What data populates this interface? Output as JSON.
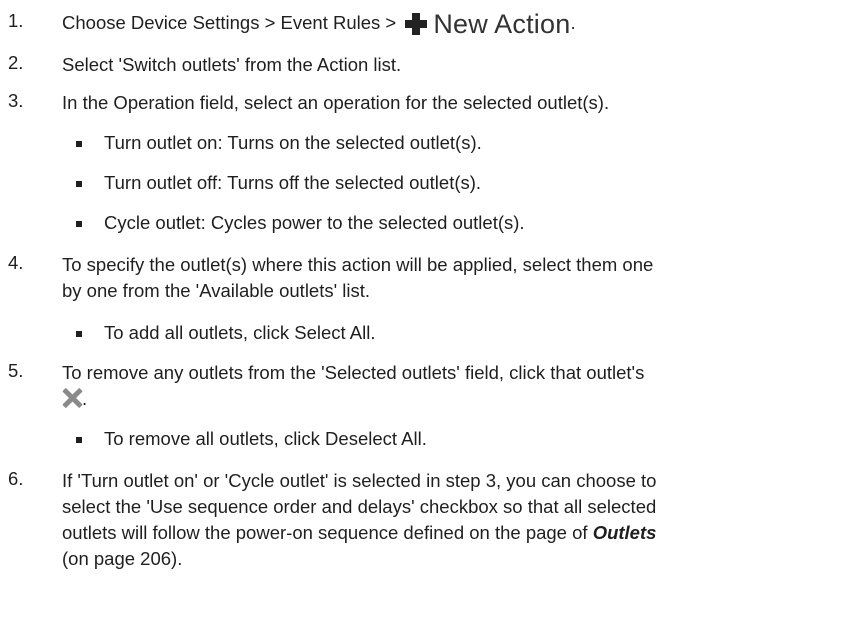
{
  "steps": [
    {
      "n": "1.",
      "text_before": "Choose Device Settings > Event Rules > ",
      "button_label": "New Action",
      "text_after": "."
    },
    {
      "n": "2.",
      "text": "Select 'Switch outlets' from the Action list."
    },
    {
      "n": "3.",
      "text": "In the Operation field, select an operation for the selected outlet(s).",
      "subs": [
        "Turn outlet on: Turns on the selected outlet(s).",
        "Turn outlet off: Turns off the selected outlet(s).",
        "Cycle outlet: Cycles power to the selected outlet(s)."
      ]
    },
    {
      "n": "4.",
      "line1": "To specify the outlet(s) where this action will be applied, select them one",
      "line2": "by one from the 'Available outlets' list.",
      "subs": [
        "To add all outlets, click Select All."
      ]
    },
    {
      "n": "5.",
      "line1": "To remove any outlets from the 'Selected outlets' field, click that outlet's",
      "line2_after": ".",
      "subs": [
        "To remove all outlets, click Deselect All."
      ]
    },
    {
      "n": "6.",
      "line1": "If 'Turn outlet on' or 'Cycle outlet' is selected in step 3, you can choose to",
      "line2": "select the 'Use sequence order and delays' checkbox so that all selected",
      "line3_before": "outlets will follow the power-on sequence defined on the page of ",
      "line3_link": "Outlets",
      "line4": "(on page 206)."
    }
  ],
  "icons": {
    "plus": "plus-icon",
    "close": "close-icon"
  }
}
